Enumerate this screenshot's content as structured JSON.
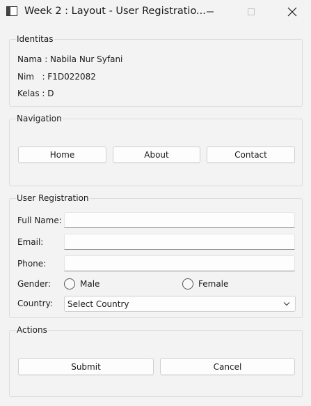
{
  "window": {
    "title": "Week 2 : Layout - User Registratio...",
    "icons": {
      "app": "app-window-icon",
      "minimize": "minimize-icon",
      "maximize": "maximize-icon",
      "close": "close-icon"
    }
  },
  "identitas": {
    "title": "Identitas",
    "nama": "Nama : Nabila Nur Syfani",
    "nim": "Nim   : F1D022082",
    "kelas": "Kelas : D"
  },
  "navigation": {
    "title": "Navigation",
    "home": "Home",
    "about": "About",
    "contact": "Contact"
  },
  "registration": {
    "title": "User Registration",
    "full_name_label": "Full Name:",
    "full_name_value": "",
    "email_label": "Email:",
    "email_value": "",
    "phone_label": "Phone:",
    "phone_value": "",
    "gender_label": "Gender:",
    "gender_male": "Male",
    "gender_female": "Female",
    "gender_selected": "",
    "country_label": "Country:",
    "country_selected": "Select Country"
  },
  "actions": {
    "title": "Actions",
    "submit": "Submit",
    "cancel": "Cancel"
  }
}
